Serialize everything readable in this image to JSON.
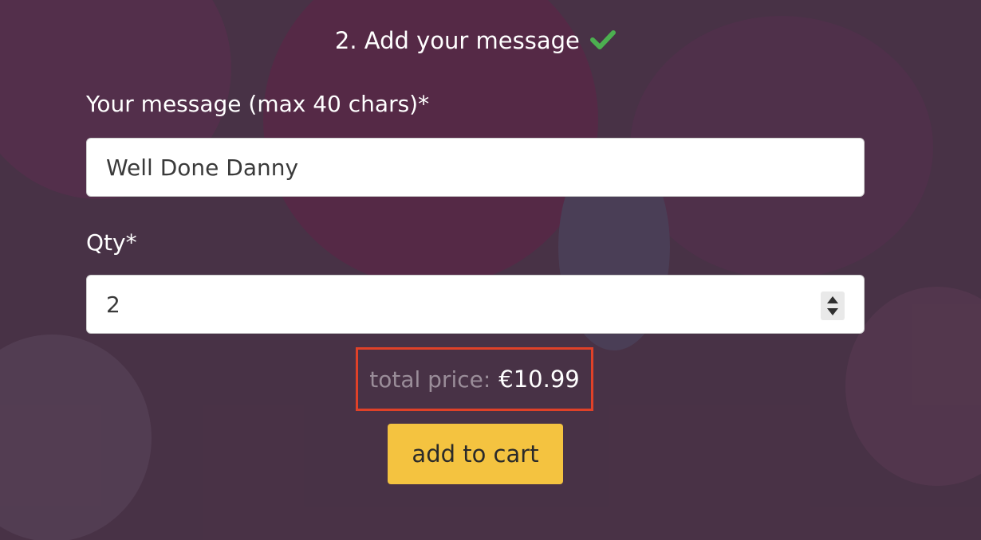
{
  "step": {
    "title": "2. Add your message"
  },
  "message": {
    "label": "Your message (max 40 chars)*",
    "value": "Well Done Danny"
  },
  "qty": {
    "label": "Qty*",
    "value": "2"
  },
  "price": {
    "label": "total price:",
    "value": "€10.99"
  },
  "cart": {
    "button_label": "add to cart"
  },
  "colors": {
    "accent_button": "#f4c340",
    "check": "#4caf50",
    "highlight_border": "#e04128"
  },
  "icons": {
    "step_done": "check-icon",
    "qty_control": "stepper-icon"
  }
}
